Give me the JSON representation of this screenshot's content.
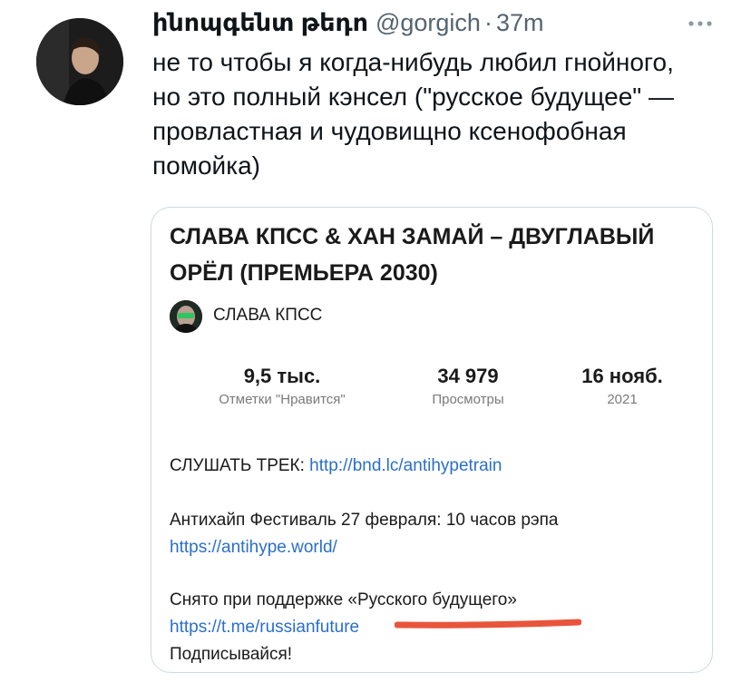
{
  "tweet": {
    "author_name": "ինոպգենտ թեդո",
    "handle": "@gorgich",
    "separator": "·",
    "time": "37m",
    "text": "не то чтобы я когда-нибудь любил гнойного, но это полный кэнсел (\"русское будущее\" — провластная и чудовищно ксенофобная помойка)"
  },
  "card": {
    "title": "СЛАВА КПСС & ХАН ЗАМАЙ – ДВУГЛАВЫЙ ОРЁЛ (ПРЕМЬЕРА 2030)",
    "channel_name": "СЛАВА КПСС",
    "stats": [
      {
        "value": "9,5 тыс.",
        "label": "Отметки \"Нравится\""
      },
      {
        "value": "34 979",
        "label": "Просмотры"
      },
      {
        "value": "16 нояб.",
        "label": "2021"
      }
    ],
    "description": {
      "line1_text": "СЛУШАТЬ ТРЕК: ",
      "line1_link": "http://bnd.lc/antihypetrain",
      "line2_text": "Антихайп Фестиваль 27 февраля: 10 часов рэпа ",
      "line2_link": "https://antihype.world/",
      "line3_text": "Снято при поддержке «Русского будущего» ",
      "line3_link": "https://t.me/russianfuture",
      "line4_text": "Подписывайся!"
    }
  },
  "colors": {
    "text": "#0f1419",
    "muted": "#536471",
    "link": "#2a6fc9",
    "border": "#cfd9de",
    "highlight": "#e8553c"
  },
  "icons": {
    "more": "more-horizontal-icon"
  }
}
